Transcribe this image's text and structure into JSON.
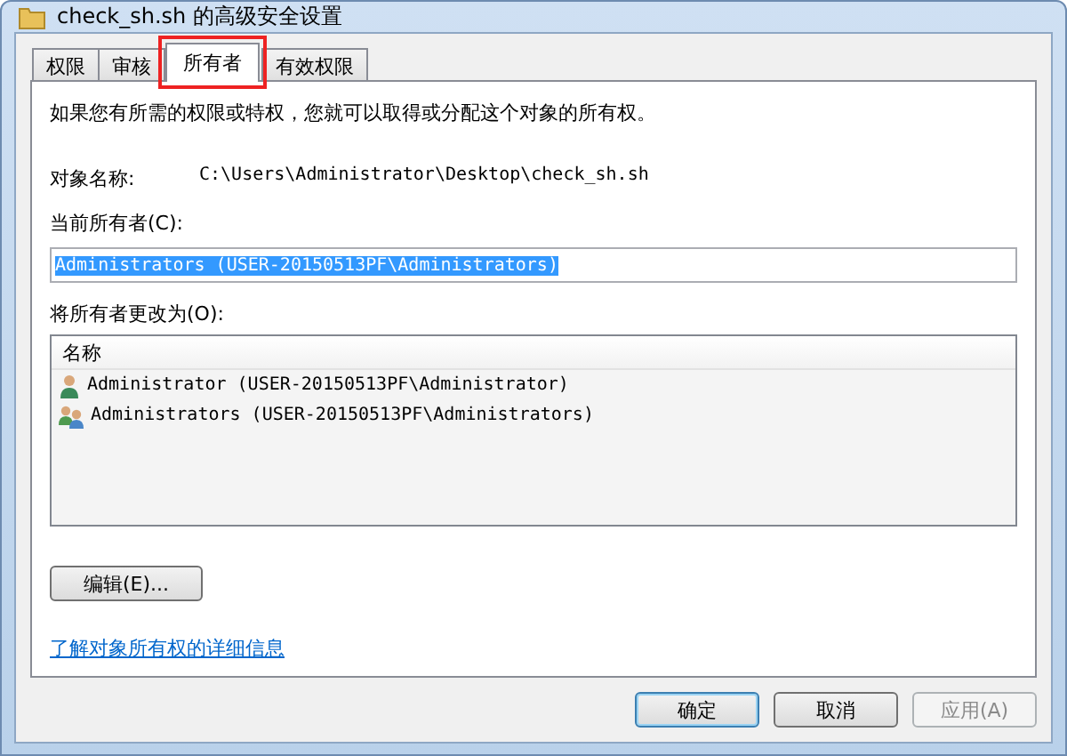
{
  "window": {
    "title": "check_sh.sh 的高级安全设置"
  },
  "tabs": [
    {
      "label": "权限",
      "selected": false,
      "highlighted": false
    },
    {
      "label": "审核",
      "selected": false,
      "highlighted": false
    },
    {
      "label": "所有者",
      "selected": true,
      "highlighted": true
    },
    {
      "label": "有效权限",
      "selected": false,
      "highlighted": false
    }
  ],
  "description": "如果您有所需的权限或特权，您就可以取得或分配这个对象的所有权。",
  "object_name": {
    "label": "对象名称:",
    "value": "C:\\Users\\Administrator\\Desktop\\check_sh.sh"
  },
  "current_owner": {
    "label": "当前所有者(C):",
    "value": "Administrators (USER-20150513PF\\Administrators)"
  },
  "change_owner": {
    "label": "将所有者更改为(O):",
    "column": "名称",
    "items": [
      {
        "kind": "user",
        "name": "Administrator (USER-20150513PF\\Administrator)",
        "selected": false
      },
      {
        "kind": "group",
        "name": "Administrators (USER-20150513PF\\Administrators)",
        "selected": false
      }
    ]
  },
  "edit_button": "编辑(E)...",
  "link": "了解对象所有权的详细信息",
  "buttons": [
    {
      "label": "确定",
      "default": true,
      "disabled": false
    },
    {
      "label": "取消",
      "default": false,
      "disabled": false
    },
    {
      "label": "应用(A)",
      "default": false,
      "disabled": true
    }
  ]
}
